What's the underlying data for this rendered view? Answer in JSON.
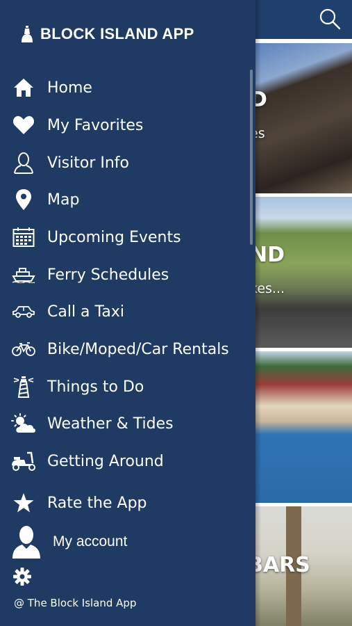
{
  "app": {
    "title": "BLOCK ISLAND APP"
  },
  "background": {
    "cards": [
      {
        "title": "D",
        "subtitle": "es"
      },
      {
        "title": "ND",
        "subtitle": "kes..."
      },
      {
        "title": "",
        "subtitle": ""
      },
      {
        "title": "BARS",
        "subtitle": ""
      }
    ]
  },
  "menu": {
    "items": [
      {
        "label": "Home",
        "icon": "home-icon"
      },
      {
        "label": "My Favorites",
        "icon": "heart-icon"
      },
      {
        "label": "Visitor Info",
        "icon": "person-outline-icon"
      },
      {
        "label": "Map",
        "icon": "map-pin-icon"
      },
      {
        "label": "Upcoming Events",
        "icon": "calendar-icon"
      },
      {
        "label": "Ferry Schedules",
        "icon": "ferry-icon"
      },
      {
        "label": "Call a Taxi",
        "icon": "car-icon"
      },
      {
        "label": "Bike/Moped/Car Rentals",
        "icon": "bicycle-icon"
      },
      {
        "label": "Things to Do",
        "icon": "lighthouse-icon"
      },
      {
        "label": "Weather & Tides",
        "icon": "sun-cloud-icon"
      },
      {
        "label": "Getting Around",
        "icon": "scooter-icon"
      },
      {
        "label": "Rate the App",
        "icon": "star-icon"
      },
      {
        "label": "My account",
        "icon": "person-icon"
      }
    ]
  },
  "footer": {
    "text": "@ The Block Island App"
  },
  "colors": {
    "drawer": "#1f3a63",
    "header": "#1f3f6c",
    "text": "#ffffff"
  }
}
